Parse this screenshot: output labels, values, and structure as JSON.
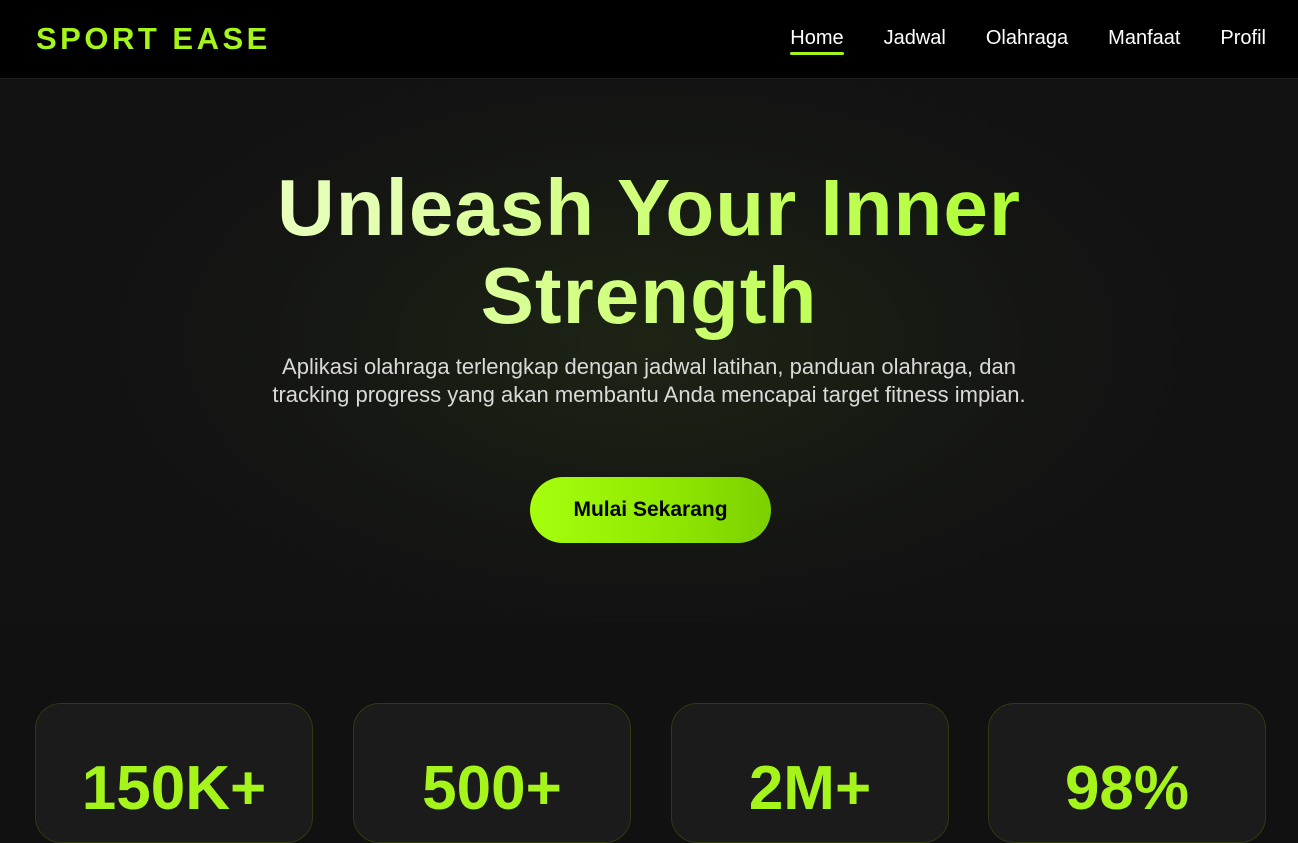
{
  "brand": {
    "name": "SPORT EASE"
  },
  "nav": {
    "items": [
      {
        "label": "Home",
        "active": true
      },
      {
        "label": "Jadwal",
        "active": false
      },
      {
        "label": "Olahraga",
        "active": false
      },
      {
        "label": "Manfaat",
        "active": false
      },
      {
        "label": "Profil",
        "active": false
      }
    ]
  },
  "hero": {
    "title_line1": "Unleash Your Inner",
    "title_line2": "Strength",
    "description": "Aplikasi olahraga terlengkap dengan jadwal latihan, panduan olahraga, dan tracking progress yang akan membantu Anda mencapai target fitness impian.",
    "cta_label": "Mulai Sekarang"
  },
  "stats": [
    {
      "value": "150K+"
    },
    {
      "value": "500+"
    },
    {
      "value": "2M+"
    },
    {
      "value": "98%"
    }
  ],
  "colors": {
    "accent": "#a6f51a",
    "background": "#111111",
    "navbar": "#000000",
    "card": "#1b1b1b"
  }
}
